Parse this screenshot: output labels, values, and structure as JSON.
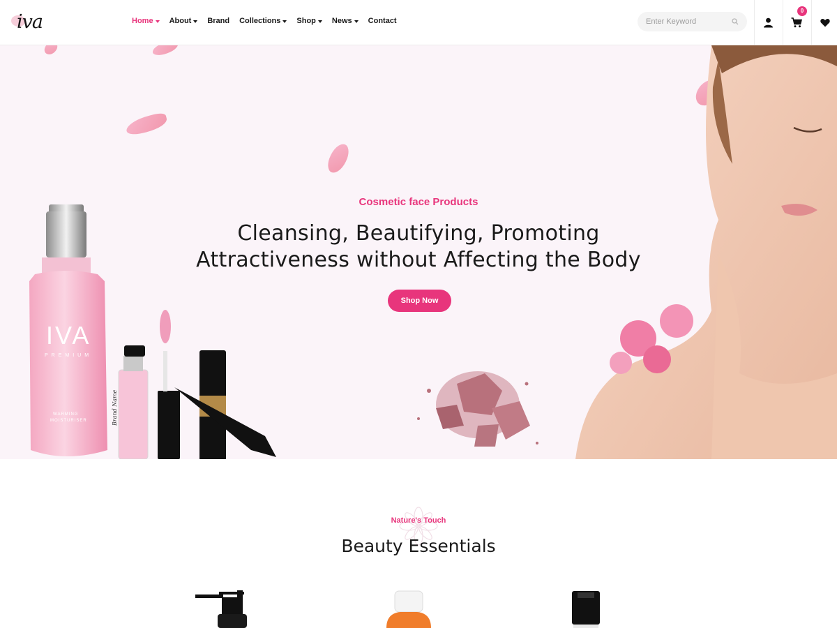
{
  "header": {
    "logo_text": "iva",
    "nav": [
      {
        "label": "Home",
        "has_caret": true,
        "active": true
      },
      {
        "label": "About",
        "has_caret": true,
        "active": false
      },
      {
        "label": "Brand",
        "has_caret": false,
        "active": false
      },
      {
        "label": "Collections",
        "has_caret": true,
        "active": false
      },
      {
        "label": "Shop",
        "has_caret": true,
        "active": false
      },
      {
        "label": "News",
        "has_caret": true,
        "active": false
      },
      {
        "label": "Contact",
        "has_caret": false,
        "active": false
      }
    ],
    "search": {
      "placeholder": "Enter Keyword",
      "value": "",
      "icon": "search-icon"
    },
    "icons": {
      "account": "user-icon",
      "cart": "cart-icon",
      "wishlist": "heart-icon"
    },
    "cart_count": "0"
  },
  "hero": {
    "subtitle": "Cosmetic face Products",
    "title_line1": "Cleansing, Beautifying, Promoting",
    "title_line2": "Attractiveness without Affecting the Body",
    "cta_label": "Shop Now",
    "bottle_brand": "IVA",
    "bottle_sub": "PREMIUM",
    "bottle_caption_1": "WARMING",
    "bottle_caption_2": "MOISTURISER",
    "gloss_brand": "Brand Name"
  },
  "section": {
    "kicker": "Nature's Touch",
    "title": "Beauty Essentials"
  },
  "colors": {
    "accent": "#e8357c",
    "hero_bg": "#fbf4f9",
    "text_dark": "#1a1a1a"
  }
}
